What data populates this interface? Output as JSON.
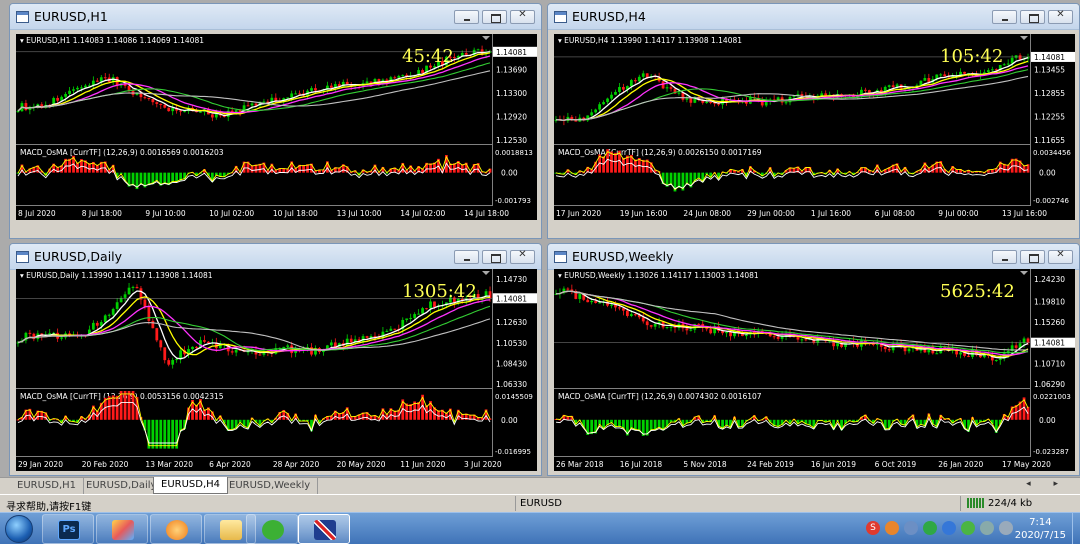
{
  "windows": [
    {
      "title": "EURUSD,H1",
      "info": "EURUSD,H1  1.14083 1.14086 1.14069 1.14081",
      "timer": "45:42",
      "prices": [
        "1.14081",
        "1.13690",
        "1.13300",
        "1.12920",
        "1.12530"
      ],
      "macd_label": "MACD_OsMA [CurrTF] (12,26,9) 0.0016569 0.0016203",
      "macd_scale": [
        "0.0018813",
        "0.00",
        "-0.001793"
      ],
      "dates": [
        "8 Jul 2020",
        "8 Jul 18:00",
        "9 Jul 10:00",
        "10 Jul 02:00",
        "10 Jul 18:00",
        "13 Jul 10:00",
        "14 Jul 02:00",
        "14 Jul 18:00"
      ]
    },
    {
      "title": "EURUSD,H4",
      "info": "EURUSD,H4  1.13990 1.14117 1.13908 1.14081",
      "timer": "105:42",
      "prices": [
        "1.14081",
        "1.13455",
        "1.12855",
        "1.12255",
        "1.11655"
      ],
      "macd_label": "MACD_OsMA [CurrTF] (12,26,9) 0.0026150 0.0017169",
      "macd_scale": [
        "0.0034456",
        "0.00",
        "-0.002746"
      ],
      "dates": [
        "17 Jun 2020",
        "19 Jun 16:00",
        "24 Jun 08:00",
        "29 Jun 00:00",
        "1 Jul 16:00",
        "6 Jul 08:00",
        "9 Jul 00:00",
        "13 Jul 16:00"
      ]
    },
    {
      "title": "EURUSD,Daily",
      "info": "EURUSD,Daily  1.13990 1.14117 1.13908 1.14081",
      "timer": "1305:42",
      "prices": [
        "1.14730",
        "1.14081",
        "1.12630",
        "1.10530",
        "1.08430",
        "1.06330"
      ],
      "macd_label": "MACD_OsMA [CurrTF] (12,26,9) 0.0053156 0.0042315",
      "macd_scale": [
        "0.0145509",
        "0.00",
        "-0.016995"
      ],
      "dates": [
        "29 Jan 2020",
        "20 Feb 2020",
        "13 Mar 2020",
        "6 Apr 2020",
        "28 Apr 2020",
        "20 May 2020",
        "11 Jun 2020",
        "3 Jul 2020"
      ]
    },
    {
      "title": "EURUSD,Weekly",
      "info": "EURUSD,Weekly  1.13026 1.14117 1.13003 1.14081",
      "timer": "5625:42",
      "prices": [
        "1.24230",
        "1.19810",
        "1.15260",
        "1.14081",
        "1.10710",
        "1.06290"
      ],
      "macd_label": "MACD_OsMA [CurrTF] (12,26,9) 0.0074302 0.0016107",
      "macd_scale": [
        "0.0221003",
        "0.00",
        "-0.023287"
      ],
      "dates": [
        "26 Mar 2018",
        "16 Jul 2018",
        "5 Nov 2018",
        "24 Feb 2019",
        "16 Jun 2019",
        "6 Oct 2019",
        "26 Jan 2020",
        "17 May 2020"
      ]
    }
  ],
  "tabs": [
    "EURUSD,H1",
    "EURUSD,Daily",
    "EURUSD,H4",
    "EURUSD,Weekly"
  ],
  "active_tab": "EURUSD,H4",
  "tab_arrows": "◂ ▸",
  "status": {
    "help": "寻求帮助,请按F1键",
    "symbol": "EURUSD",
    "traffic": "224/4 kb"
  },
  "taskbar": {
    "time": "7:14",
    "date": "2020/7/15",
    "apps": [
      "photoshop",
      "paint",
      "browser",
      "explorer",
      "wechat",
      "flag"
    ]
  },
  "colors": {
    "bull": "#00d000",
    "bear": "#ff1a1a",
    "ma_fast": "#ffffff",
    "ma_mid": "#ffff00",
    "ma_slow": "#ff33ff",
    "ma_long": "#33cc33",
    "ma_trend": "#c0c0c0",
    "timer": "#ffff55",
    "axis_text": "#ffffff"
  }
}
